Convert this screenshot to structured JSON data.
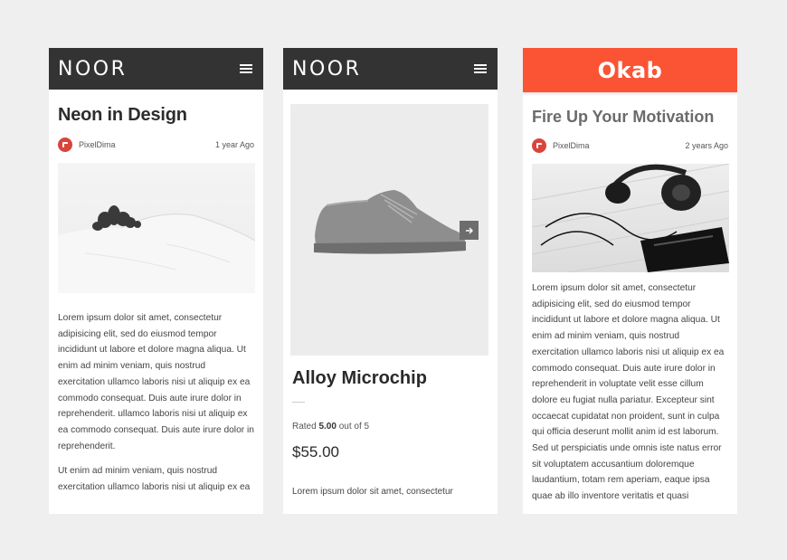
{
  "phone1": {
    "logo": "NOOR",
    "title": "Neon in Design",
    "author": "PixelDima",
    "time": "1 year Ago",
    "paragraph1": "Lorem ipsum dolor sit amet, consectetur adipisicing elit, sed do eiusmod tempor incididunt ut labore et dolore magna aliqua. Ut enim ad minim veniam, quis nostrud exercitation ullamco laboris nisi ut aliquip ex ea commodo consequat. Duis aute irure dolor in reprehenderit. ullamco laboris nisi ut aliquip ex ea commodo consequat. Duis aute irure dolor in reprehenderit.",
    "paragraph2": "Ut enim ad minim veniam, quis nostrud exercitation ullamco laboris nisi ut aliquip ex ea"
  },
  "phone2": {
    "logo": "NOOR",
    "title": "Alloy Microchip",
    "rating_prefix": "Rated ",
    "rating_value": "5.00",
    "rating_suffix": " out of 5",
    "price": "$55.00",
    "description": "Lorem ipsum dolor sit amet, consectetur"
  },
  "phone3": {
    "logo": "Okab",
    "title": "Fire Up Your Motivation",
    "author": "PixelDima",
    "time": "2 years Ago",
    "paragraph": "Lorem ipsum dolor sit amet, consectetur adipisicing elit, sed do eiusmod tempor incididunt ut labore et dolore magna aliqua. Ut enim ad minim veniam, quis nostrud exercitation ullamco laboris nisi ut aliquip ex ea commodo consequat. Duis aute irure dolor in reprehenderit in voluptate velit esse cillum dolore eu fugiat nulla pariatur. Excepteur sint occaecat cupidatat non proident, sunt in culpa qui officia deserunt mollit anim id est laborum. Sed ut perspiciatis unde omnis iste natus error sit voluptatem accusantium doloremque laudantium, totam rem aperiam, eaque ipsa quae ab illo inventore veritatis et quasi"
  },
  "colors": {
    "header_dark": "#333333",
    "header_orange": "#fa5435",
    "avatar_red": "#d9453d",
    "background": "#efefef"
  },
  "icons": [
    "menu-icon",
    "arrow-right-icon",
    "author-avatar"
  ]
}
